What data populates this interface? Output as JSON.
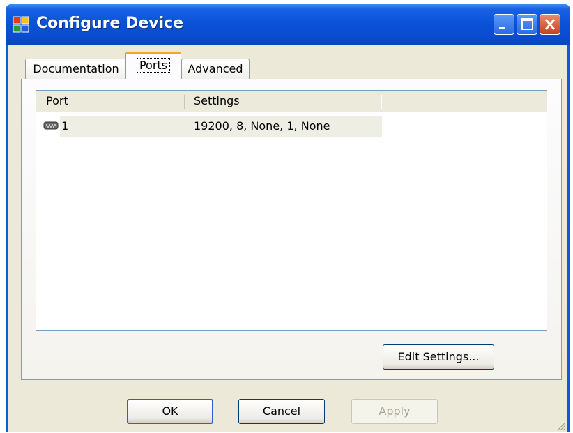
{
  "window": {
    "title": "Configure Device",
    "icons": {
      "app": "app-icon",
      "minimize": "minimize-icon",
      "maximize": "maximize-icon",
      "close": "close-icon"
    }
  },
  "tabs": [
    {
      "label": "Documentation",
      "selected": false
    },
    {
      "label": "Ports",
      "selected": true
    },
    {
      "label": "Advanced",
      "selected": false
    }
  ],
  "ports_list": {
    "columns": [
      "Port",
      "Settings"
    ],
    "rows": [
      {
        "icon": "serial-port-icon",
        "port": "1",
        "settings": "19200, 8, None, 1, None"
      }
    ]
  },
  "buttons": {
    "edit_settings": "Edit Settings...",
    "ok": "OK",
    "cancel": "Cancel",
    "apply": "Apply"
  },
  "colors": {
    "titlebar": "#0a52d8",
    "dialog_bg": "#ece9d8",
    "tab_accent": "#f5a623",
    "close_button": "#c8401f"
  }
}
